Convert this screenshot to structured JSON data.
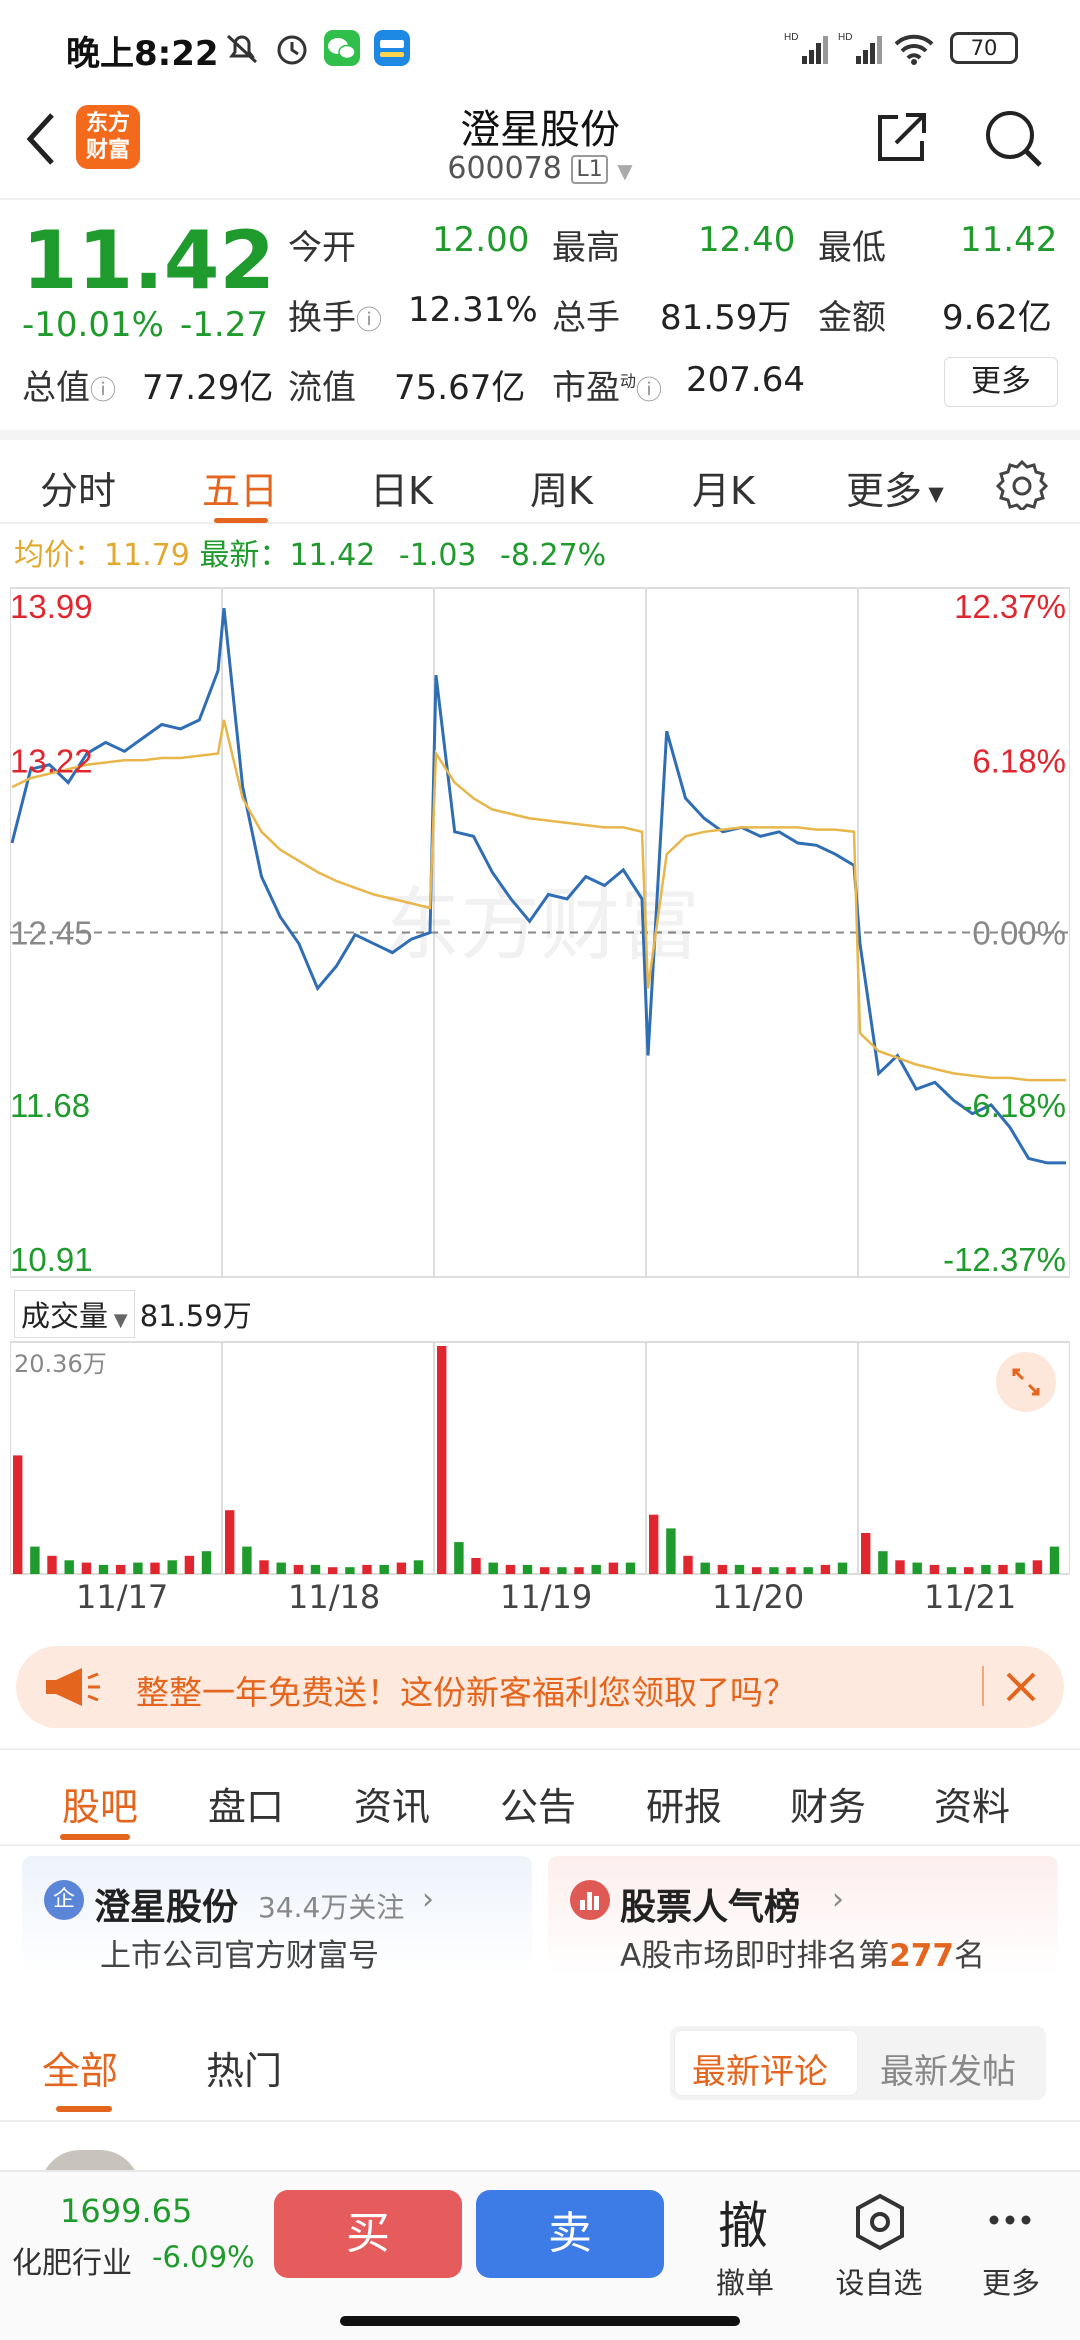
{
  "status_bar": {
    "time": "晚上8:22",
    "signal1": "HD",
    "signal2": "HD",
    "battery": "70"
  },
  "nav": {
    "logo_line1": "东方",
    "logo_line2": "财富",
    "title": "澄星股份",
    "code": "600078",
    "level": "L1"
  },
  "quote": {
    "price": "11.42",
    "change_pct": "-10.01%",
    "change": "-1.27",
    "open_label": "今开",
    "open": "12.00",
    "high_label": "最高",
    "high": "12.40",
    "low_label": "最低",
    "low": "11.42",
    "turnover_label": "换手",
    "turnover": "12.31%",
    "volume_label": "总手",
    "volume": "81.59万",
    "amount_label": "金额",
    "amount": "9.62亿",
    "mktcap_label": "总值",
    "mktcap": "77.29亿",
    "float_label": "流值",
    "float": "75.67亿",
    "pe_label": "市盈",
    "pe_sup": "动",
    "pe": "207.64",
    "more": "更多"
  },
  "chart_tabs": [
    "分时",
    "五日",
    "日K",
    "周K",
    "月K",
    "更多"
  ],
  "avg_info": {
    "avg_label": "均价：",
    "avg": "11.79",
    "last_label": "最新：",
    "last": "11.42",
    "chg": "-1.03",
    "chg_pct": "-8.27%"
  },
  "chart_data": {
    "type": "line",
    "y_left_ticks": [
      "13.99",
      "13.22",
      "12.45",
      "11.68",
      "10.91"
    ],
    "y_right_ticks": [
      "12.37%",
      "6.18%",
      "0.00%",
      "-6.18%",
      "-12.37%"
    ],
    "ylim": [
      10.91,
      13.99
    ],
    "baseline": 12.45,
    "x_labels": [
      "11/17",
      "11/18",
      "11/19",
      "11/20",
      "11/21"
    ],
    "watermark": "东方财富",
    "series": [
      {
        "name": "price",
        "day_values": [
          [
            12.85,
            13.18,
            13.2,
            13.12,
            13.25,
            13.3,
            13.26,
            13.32,
            13.38,
            13.36,
            13.4,
            13.62
          ],
          [
            13.9,
            13.1,
            12.7,
            12.52,
            12.4,
            12.2,
            12.3,
            12.44,
            12.4,
            12.36,
            12.42,
            12.45
          ],
          [
            13.6,
            12.9,
            12.88,
            12.72,
            12.6,
            12.5,
            12.62,
            12.6,
            12.7,
            12.66,
            12.73,
            12.6
          ],
          [
            11.9,
            13.35,
            13.05,
            12.96,
            12.9,
            12.92,
            12.88,
            12.9,
            12.85,
            12.84,
            12.8,
            12.75
          ],
          [
            12.4,
            11.82,
            11.9,
            11.75,
            11.78,
            11.7,
            11.64,
            11.68,
            11.58,
            11.44,
            11.42,
            11.42
          ]
        ]
      },
      {
        "name": "avg",
        "day_values": [
          [
            13.1,
            13.14,
            13.16,
            13.18,
            13.2,
            13.21,
            13.22,
            13.22,
            13.23,
            13.23,
            13.24,
            13.25
          ],
          [
            13.4,
            13.05,
            12.9,
            12.82,
            12.77,
            12.72,
            12.68,
            12.65,
            12.62,
            12.6,
            12.58,
            12.56
          ],
          [
            13.25,
            13.12,
            13.05,
            13.0,
            12.98,
            12.96,
            12.95,
            12.94,
            12.93,
            12.92,
            12.92,
            12.9
          ],
          [
            12.2,
            12.8,
            12.88,
            12.9,
            12.91,
            12.92,
            12.92,
            12.92,
            12.92,
            12.91,
            12.91,
            12.9
          ],
          [
            12.0,
            11.92,
            11.89,
            11.86,
            11.84,
            11.82,
            11.81,
            11.8,
            11.8,
            11.79,
            11.79,
            11.79
          ]
        ]
      }
    ]
  },
  "volume": {
    "label": "成交量",
    "total": "81.59万",
    "max": "20.36万"
  },
  "volume_data": [
    [
      0.52,
      0.12,
      0.08,
      0.06,
      0.05,
      0.04,
      0.04,
      0.05,
      0.05,
      0.06,
      0.08,
      0.1
    ],
    [
      0.28,
      0.12,
      0.06,
      0.05,
      0.04,
      0.04,
      0.03,
      0.03,
      0.04,
      0.04,
      0.05,
      0.06
    ],
    [
      1.0,
      0.14,
      0.07,
      0.05,
      0.04,
      0.04,
      0.03,
      0.03,
      0.03,
      0.04,
      0.05,
      0.05
    ],
    [
      0.26,
      0.2,
      0.08,
      0.05,
      0.04,
      0.04,
      0.03,
      0.03,
      0.03,
      0.03,
      0.04,
      0.05
    ],
    [
      0.18,
      0.1,
      0.06,
      0.05,
      0.04,
      0.03,
      0.03,
      0.04,
      0.04,
      0.05,
      0.06,
      0.12
    ]
  ],
  "banner": {
    "text": "整整一年免费送！这份新客福利您领取了吗？"
  },
  "section_tabs": [
    "股吧",
    "盘口",
    "资讯",
    "公告",
    "研报",
    "财务",
    "资料"
  ],
  "card_company": {
    "badge": "企",
    "title": "澄星股份",
    "followers": "34.4万关注",
    "sub": "上市公司官方财富号"
  },
  "card_rank": {
    "title": "股票人气榜",
    "sub_prefix": "A股市场即时排名第",
    "rank": "277",
    "sub_suffix": "名"
  },
  "comment_tabs": {
    "all": "全部",
    "hot": "热门",
    "newest_comment": "最新评论",
    "newest_post": "最新发帖"
  },
  "bottom_bar": {
    "index_value": "1699.65",
    "industry": "化肥行业",
    "industry_chg": "-6.09%",
    "buy": "买",
    "sell": "卖",
    "cancel_icon": "撤",
    "cancel": "撤单",
    "watch": "设自选",
    "more": "更多"
  },
  "colors": {
    "up": "#e0272f",
    "down": "#1f9a2c",
    "accent": "#e4651d",
    "price_line": "#2f6db5",
    "avg_line": "#e8b64a"
  }
}
